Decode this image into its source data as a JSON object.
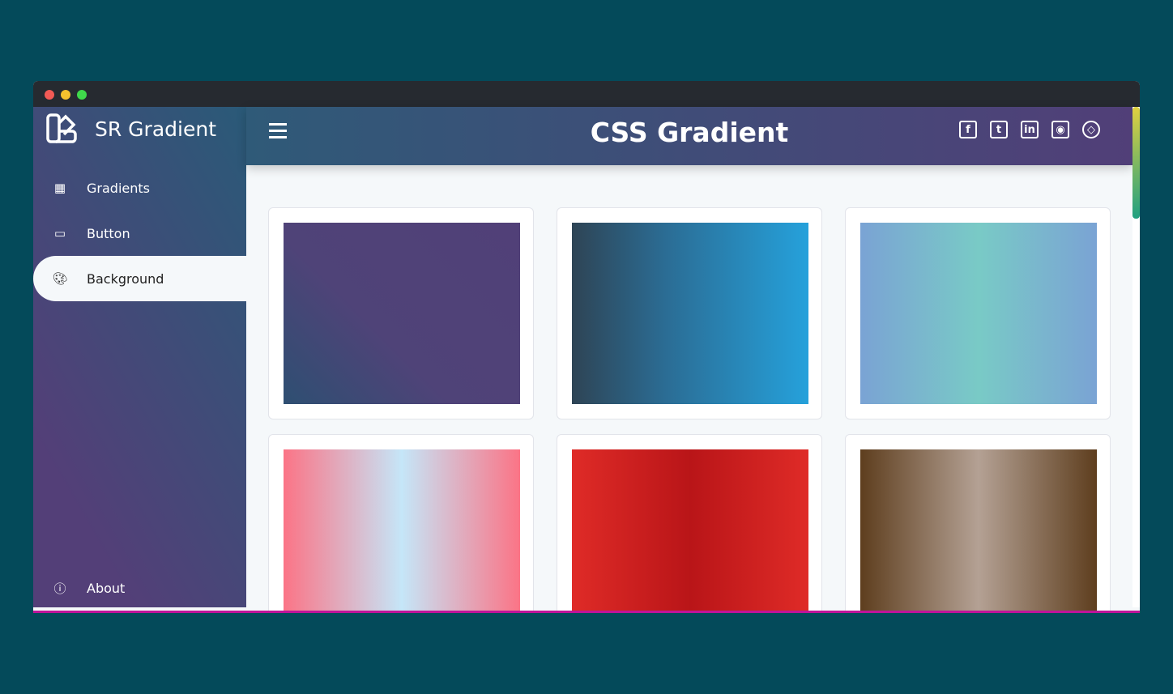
{
  "app": {
    "brand": "SR Gradient",
    "title": "CSS Gradient"
  },
  "sidebar": {
    "items": [
      {
        "label": "Gradients",
        "icon": "calculator-icon"
      },
      {
        "label": "Button",
        "icon": "button-icon"
      },
      {
        "label": "Background",
        "icon": "palette-icon",
        "active": true
      }
    ],
    "footer": {
      "label": "About",
      "icon": "info-icon"
    }
  },
  "social": [
    "facebook",
    "twitter",
    "linkedin",
    "github",
    "codepen"
  ],
  "gradients": [
    {
      "css": "linear-gradient(45deg,#2e4f72,#4f4378 40%,#514078)"
    },
    {
      "css": "linear-gradient(90deg,#2e4455,#2b6d95 40%,#25a1db)"
    },
    {
      "css": "linear-gradient(90deg,#7aa3d4,#79cac6 50%,#7aa3d4)"
    },
    {
      "css": "linear-gradient(90deg,#fb7486,#c5e6f8 50%,#fb7486)"
    },
    {
      "css": "linear-gradient(90deg,#df2b27,#b91518 50%,#df2b27)"
    },
    {
      "css": "linear-gradient(90deg,#5e3e1e,#b4a194 50%,#5e3e1e)"
    }
  ]
}
